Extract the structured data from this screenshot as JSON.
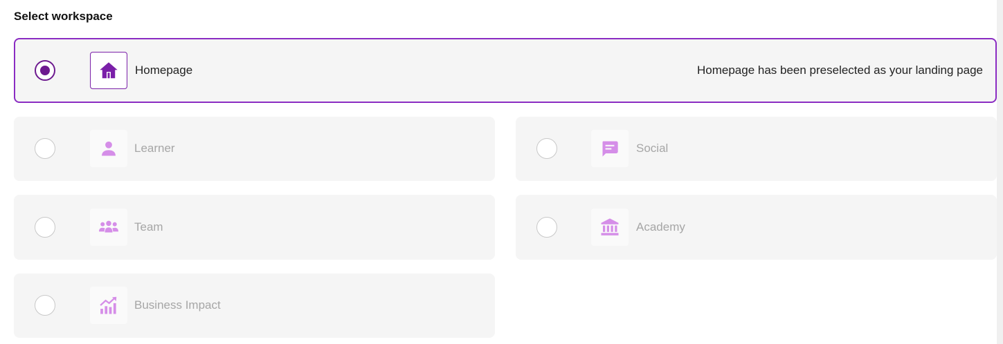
{
  "page": {
    "title": "Select workspace"
  },
  "workspaces": [
    {
      "label": "Homepage",
      "icon": "home-icon",
      "selected": true,
      "note": "Homepage has been preselected as your landing page"
    },
    {
      "label": "Learner",
      "icon": "person-icon",
      "selected": false
    },
    {
      "label": "Social",
      "icon": "chat-icon",
      "selected": false
    },
    {
      "label": "Team",
      "icon": "group-icon",
      "selected": false
    },
    {
      "label": "Academy",
      "icon": "institution-icon",
      "selected": false
    },
    {
      "label": "Business Impact",
      "icon": "chart-trend-icon",
      "selected": false
    }
  ],
  "colors": {
    "accent": "#8a2bc2",
    "accent_dark": "#6d1a8f",
    "icon_muted": "#d58ee8",
    "card_bg": "#f5f5f5",
    "muted_text": "#a6a6a6"
  }
}
